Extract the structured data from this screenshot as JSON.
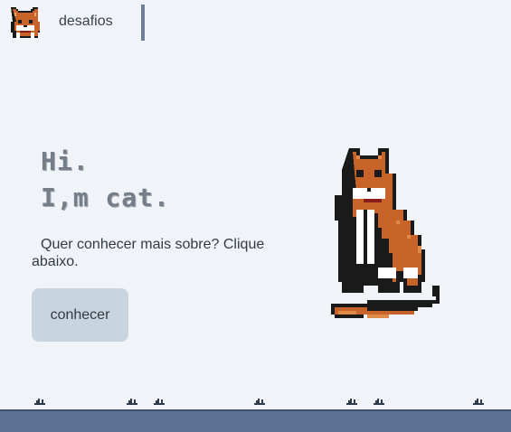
{
  "nav": {
    "logo_icon": "pixel-cat-face-icon",
    "link_label": "desafios"
  },
  "hero": {
    "greeting": "Hi.",
    "intro_line": "I,m cat.",
    "description": "Quer conhecer mais sobre? Clique abaixo.",
    "button_label": "conhecer"
  },
  "illustration": "pixel-cat-sitting-icon",
  "colors": {
    "background": "#f0f4f8",
    "cat_orange": "#c8642a",
    "button": "#c9d5de",
    "ground": "#5b7093",
    "accent_bar": "#6d7f96"
  }
}
